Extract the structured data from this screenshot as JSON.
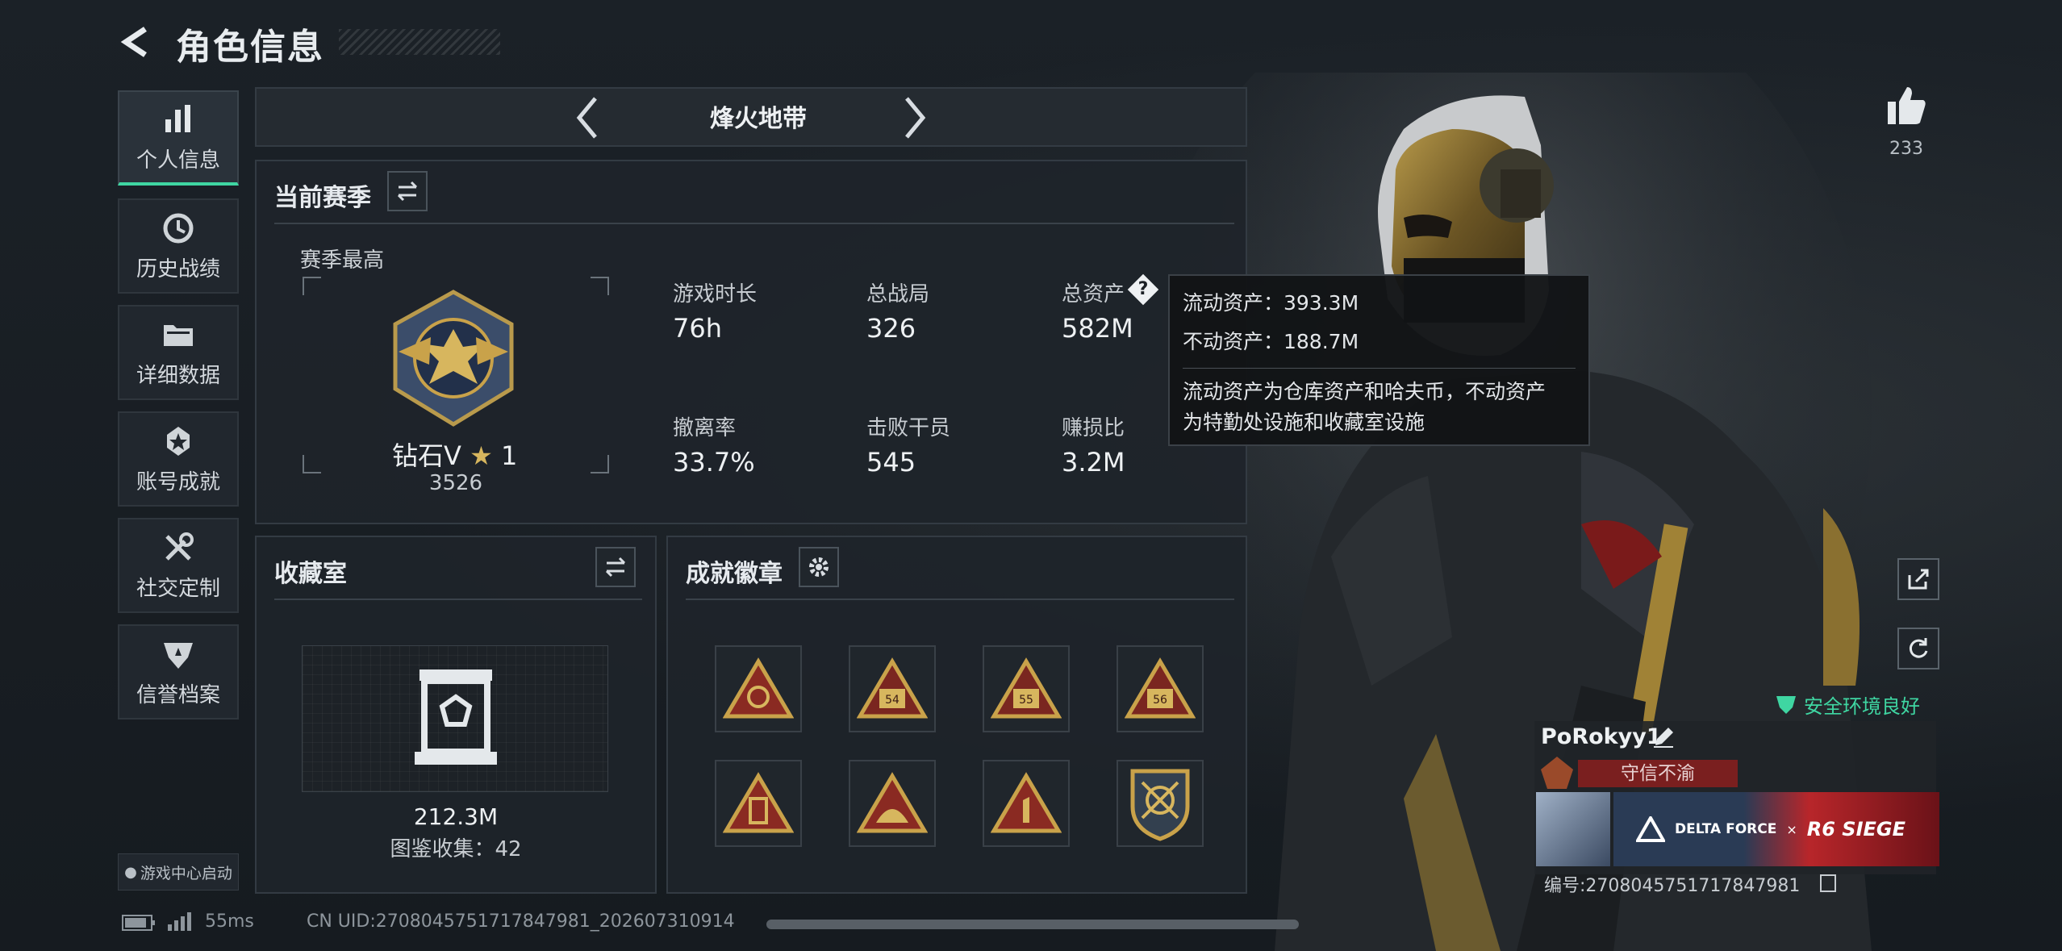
{
  "header": {
    "title": "角色信息"
  },
  "sidebar": {
    "items": [
      {
        "label": "个人信息",
        "icon": "bar-chart-icon",
        "active": true
      },
      {
        "label": "历史战绩",
        "icon": "clock-icon"
      },
      {
        "label": "详细数据",
        "icon": "folder-icon"
      },
      {
        "label": "账号成就",
        "icon": "medal-icon"
      },
      {
        "label": "社交定制",
        "icon": "tools-icon"
      },
      {
        "label": "信誉档案",
        "icon": "shield-icon"
      }
    ],
    "launch_label": "游戏中心启动"
  },
  "mode_selector": {
    "label": "烽火地带"
  },
  "season": {
    "title": "当前赛季",
    "best_label": "赛季最高",
    "rank_name": "钻石V",
    "rank_stars": "1",
    "rank_score": "3526",
    "stats": [
      {
        "label": "游戏时长",
        "value": "76h"
      },
      {
        "label": "总战局",
        "value": "326"
      },
      {
        "label": "总资产",
        "value": "582M"
      },
      {
        "label": "撤离率",
        "value": "33.7%"
      },
      {
        "label": "击败干员",
        "value": "545"
      },
      {
        "label": "赚损比",
        "value": "3.2M"
      }
    ]
  },
  "tooltip": {
    "liquid": "流动资产：393.3M",
    "fixed": "不动资产：188.7M",
    "note_line1": "流动资产为仓库资产和哈夫币，不动资产",
    "note_line2": "为特勤处设施和收藏室设施"
  },
  "collection": {
    "title": "收藏室",
    "value": "212.3M",
    "count": "图鉴收集：42"
  },
  "achievements": {
    "title": "成就徽章",
    "badges": [
      "54",
      "55",
      "56"
    ]
  },
  "player": {
    "likes": "233",
    "safety": "安全环境良好",
    "name": "PoRokyy1",
    "credit_tag": "守信不渝",
    "banner_left": "DELTA FORCE",
    "banner_x": "×",
    "banner_right": "R6 SIEGE",
    "id_text": "编号:270804575171784798​1"
  },
  "footer": {
    "ping": "55ms",
    "uid": "CN UID:2708045751717847981_202607310914"
  },
  "colors": {
    "accent": "#3fd6a2",
    "gold": "#c9a24a",
    "tag_red": "#7a1f1f"
  }
}
